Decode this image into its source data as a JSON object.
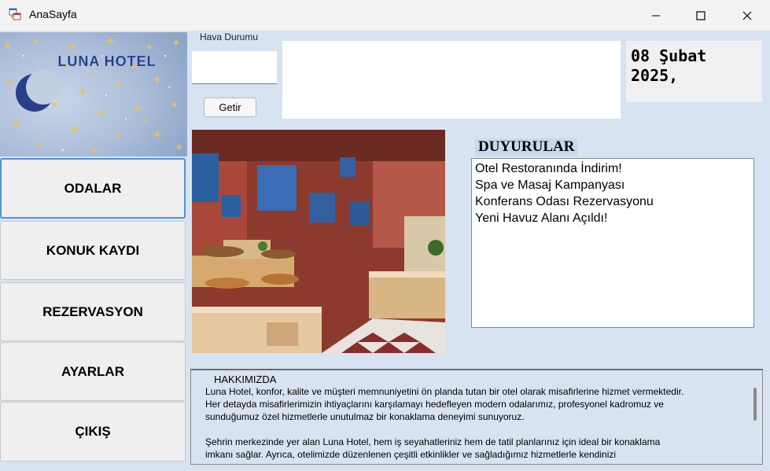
{
  "window": {
    "title": "AnaSayfa"
  },
  "logo": {
    "text": "LUNA HOTEL"
  },
  "nav": [
    {
      "label": "ODALAR"
    },
    {
      "label": "KONUK KAYDI"
    },
    {
      "label": "REZERVASYON"
    },
    {
      "label": "AYARLAR"
    },
    {
      "label": "ÇIKIŞ"
    }
  ],
  "weather": {
    "label": "Hava Durumu",
    "input_value": "",
    "button_label": "Getir",
    "result_text": ""
  },
  "date": {
    "line1": "08 Şubat",
    "line2": "2025,"
  },
  "announcements": {
    "title": "DUYURULAR",
    "items": [
      "Otel Restoranında İndirim!",
      "Spa ve Masaj Kampanyası",
      "Konferans Odası Rezervasyonu",
      "Yeni Havuz Alanı Açıldı!"
    ]
  },
  "about": {
    "title": "HAKKIMIZDA",
    "paragraph1": "Luna Hotel, konfor, kalite ve müşteri memnuniyetini ön planda tutan bir otel olarak misafirlerine hizmet vermektedir.\nHer detayda misafirlerimizin ihtiyaçlarını karşılamayı hedefleyen modern odalarımız, profesyonel kadromuz ve\nsunduğumuz özel hizmetlerle unutulmaz bir konaklama deneyimi sunuyoruz.",
    "paragraph2": "Şehrin merkezinde yer alan Luna Hotel, hem iş seyahatleriniz hem de tatil planlarınız için ideal bir konaklama\n imkanı sağlar. Ayrıca, otelimizde düzenlenen çeşitli etkinlikler ve sağladığımız hizmetlerle kendinizi"
  },
  "colors": {
    "client_bg": "#d7e3f1",
    "titlebar_bg": "#f3f3f3",
    "nav_active_border": "#4f93d8",
    "logo_text": "#1f3a8a"
  },
  "icons": {
    "app": "window-app-icon",
    "minimize": "minimize-icon",
    "maximize": "maximize-icon",
    "close": "close-icon"
  }
}
